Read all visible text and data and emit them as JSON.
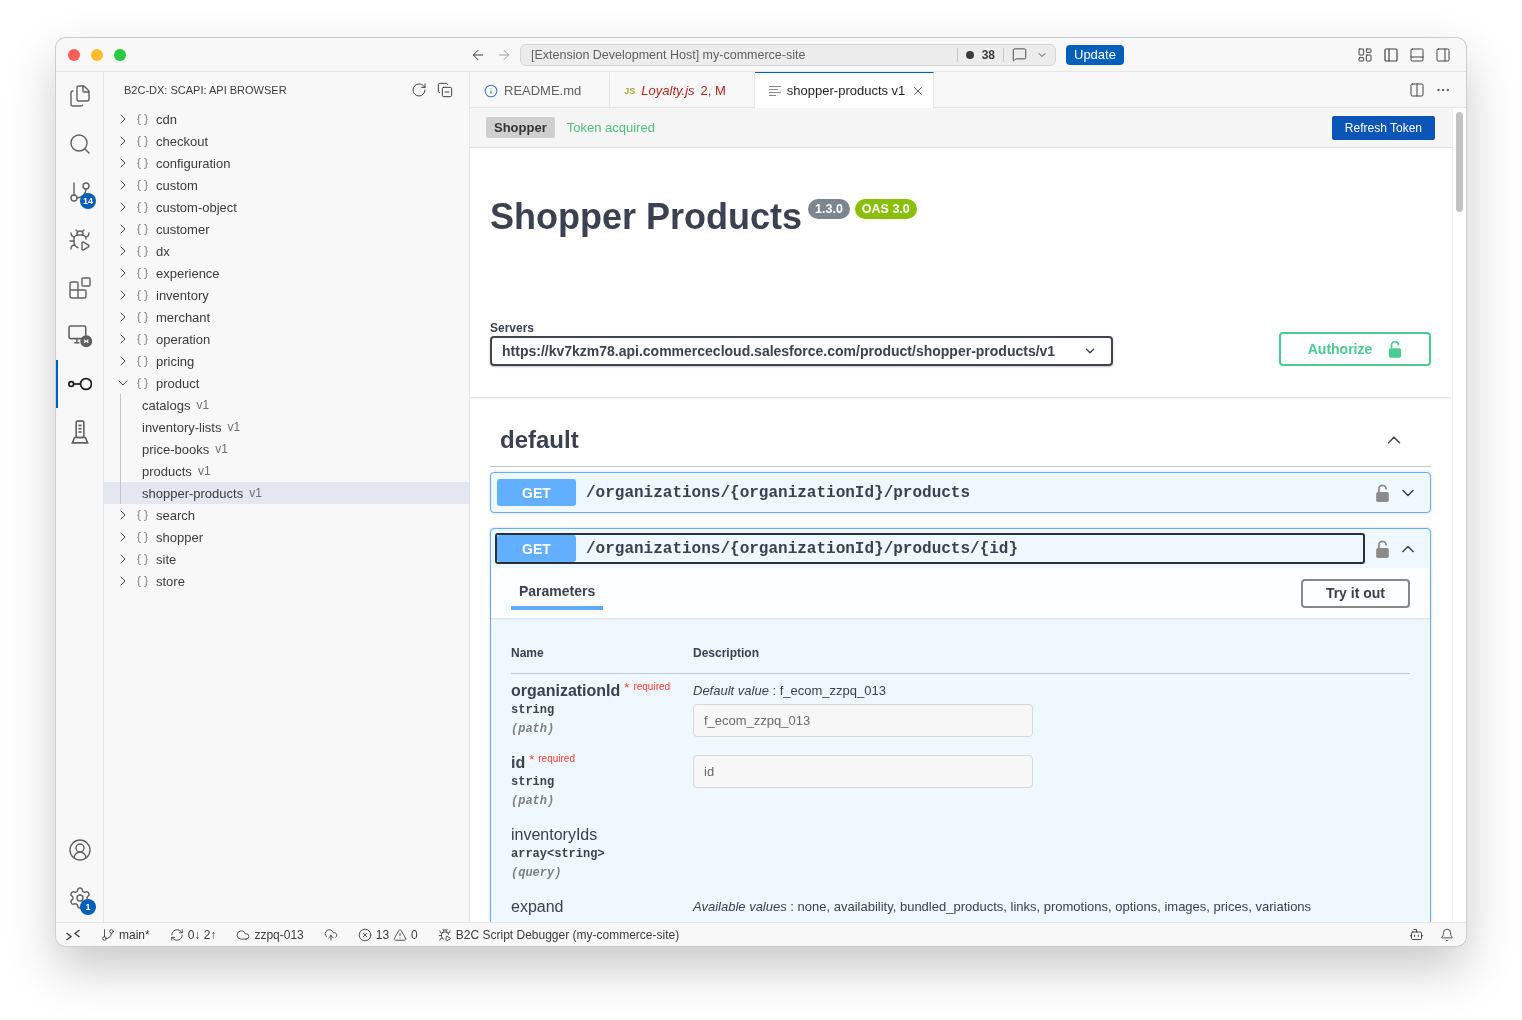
{
  "title_bar": {
    "command_center": {
      "text": "[Extension Development Host] my-commerce-site",
      "count": "38"
    },
    "update_button": "Update"
  },
  "activity_bar": {
    "top": [
      {
        "kind": "files",
        "selected": false
      },
      {
        "kind": "search",
        "selected": false
      },
      {
        "kind": "source_control",
        "selected": false,
        "badge": "14"
      },
      {
        "kind": "run_debug",
        "selected": false
      },
      {
        "kind": "extensions",
        "selected": false
      },
      {
        "kind": "remote",
        "selected": false
      },
      {
        "kind": "api",
        "selected": true
      },
      {
        "kind": "device",
        "selected": false
      }
    ],
    "bottom": [
      {
        "kind": "account",
        "selected": false
      },
      {
        "kind": "settings",
        "selected": false,
        "badge": "1"
      }
    ]
  },
  "sidebar": {
    "title": "B2C-DX: SCAPI: API BROWSER",
    "tree": [
      {
        "label": "cdn",
        "expanded": false,
        "selected": false
      },
      {
        "label": "checkout",
        "expanded": false,
        "selected": false
      },
      {
        "label": "configuration",
        "expanded": false,
        "selected": false
      },
      {
        "label": "custom",
        "expanded": false,
        "selected": false
      },
      {
        "label": "custom-object",
        "expanded": false,
        "selected": false
      },
      {
        "label": "customer",
        "expanded": false,
        "selected": false
      },
      {
        "label": "dx",
        "expanded": false,
        "selected": false
      },
      {
        "label": "experience",
        "expanded": false,
        "selected": false
      },
      {
        "label": "inventory",
        "expanded": false,
        "selected": false
      },
      {
        "label": "merchant",
        "expanded": false,
        "selected": false
      },
      {
        "label": "operation",
        "expanded": false,
        "selected": false
      },
      {
        "label": "pricing",
        "expanded": false,
        "selected": false
      },
      {
        "label": "product",
        "expanded": true,
        "selected": false,
        "children": [
          {
            "label": "catalogs",
            "version": "v1",
            "selected": false
          },
          {
            "label": "inventory-lists",
            "version": "v1",
            "selected": false
          },
          {
            "label": "price-books",
            "version": "v1",
            "selected": false
          },
          {
            "label": "products",
            "version": "v1",
            "selected": false
          },
          {
            "label": "shopper-products",
            "version": "v1",
            "selected": true
          }
        ]
      },
      {
        "label": "search",
        "expanded": false,
        "selected": false
      },
      {
        "label": "shopper",
        "expanded": false,
        "selected": false
      },
      {
        "label": "site",
        "expanded": false,
        "selected": false
      },
      {
        "label": "store",
        "expanded": false,
        "selected": false
      }
    ]
  },
  "editor_tabs": [
    {
      "kind": "info",
      "label": "README.md",
      "selected": false,
      "preview": false,
      "has_errors": false
    },
    {
      "kind": "js",
      "icon_text": "JS",
      "label": "Loyalty.js",
      "status": "2, M",
      "selected": false,
      "preview": true,
      "has_errors": true
    },
    {
      "kind": "preview",
      "label": "shopper-products v1",
      "selected": true,
      "preview": false,
      "has_errors": false
    }
  ],
  "webview": {
    "auth_bar": {
      "scope": "Shopper",
      "status": "Token acquired",
      "button": "Refresh Token"
    },
    "info": {
      "title": "Shopper Products",
      "version": "1.3.0",
      "spec": "OAS 3.0"
    },
    "servers": {
      "label": "Servers",
      "value": "https://kv7kzm78.api.commercecloud.salesforce.com/product/shopper-products/v1"
    },
    "authorize_button": "Authorize",
    "tag": {
      "name": "default",
      "expanded": true,
      "operations": [
        {
          "method": "GET",
          "path": "/organizations/{organizationId}/products",
          "expanded": false,
          "focused": false
        },
        {
          "method": "GET",
          "path": "/organizations/{organizationId}/products/{id}",
          "expanded": true,
          "focused": true,
          "parameters": {
            "tabs": [
              {
                "label": "Parameters",
                "selected": true
              }
            ],
            "try_button": "Try it out",
            "columns": [
              "Name",
              "Description"
            ],
            "rows": [
              {
                "name": "organizationId",
                "required": true,
                "required_mark": "*",
                "required_text": "required",
                "type": "string",
                "location": "(path)",
                "description": "*Default value* : f_ecom_zzpq_013",
                "input": {
                  "value": "f_ecom_zzpq_013"
                }
              },
              {
                "name": "id",
                "required": true,
                "required_mark": "*",
                "required_text": "required",
                "type": "string",
                "location": "(path)",
                "input": {
                  "placeholder": "id"
                }
              },
              {
                "name": "inventoryIds",
                "required": false,
                "type": "array<string>",
                "location": "(query)"
              },
              {
                "name": "expand",
                "required": false,
                "description": "*Available values* : none, availability, bundled_products, links, promotions, options, images, prices, variations"
              }
            ]
          }
        }
      ]
    }
  },
  "status_bar": {
    "left": [
      {
        "kind": "remote"
      },
      {
        "kind": "branch",
        "text": "main*"
      },
      {
        "kind": "sync",
        "text": "0↓ 2↑"
      },
      {
        "kind": "cloud",
        "text": "zzpq-013"
      },
      {
        "kind": "publish"
      },
      {
        "kind": "problems",
        "errors": "13",
        "warnings": "0"
      },
      {
        "kind": "debug",
        "text": "B2C Script Debugger (my-commerce-site)"
      }
    ],
    "right": [
      {
        "kind": "copilot"
      },
      {
        "kind": "notifications"
      }
    ]
  }
}
